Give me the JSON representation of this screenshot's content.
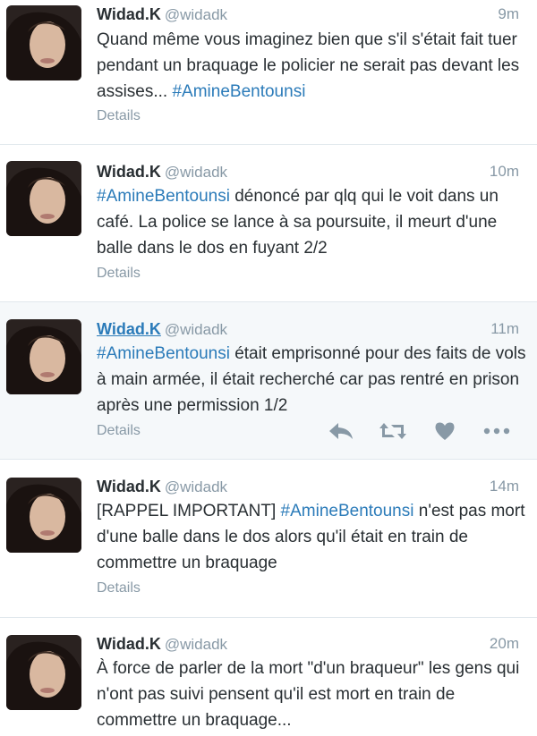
{
  "colors": {
    "name": "#292f33",
    "muted": "#8899a6",
    "hashtag": "#2b7bb9",
    "divider": "#e1e8ed",
    "hover_bg": "#f5f8fa"
  },
  "tweets": [
    {
      "name": "Widad.K",
      "handle": "@widadk",
      "time": "9m",
      "text_pre": "Quand même vous imaginez bien que s'il s'était fait tuer pendant un braquage le policier ne serait pas devant les assises... ",
      "hashtag": "#AmineBentounsi",
      "text_post": "",
      "details": "Details"
    },
    {
      "name": "Widad.K",
      "handle": "@widadk",
      "time": "10m",
      "text_pre": "",
      "hashtag": "#AmineBentounsi",
      "text_post": " dénoncé par qlq qui le voit dans un café. La police se lance à sa poursuite, il meurt d'une balle dans le dos en fuyant 2/2",
      "details": "Details"
    },
    {
      "name": "Widad.K",
      "handle": "@widadk",
      "time": "11m",
      "text_pre": "",
      "hashtag": "#AmineBentounsi",
      "text_post": " était emprisonné pour des faits de vols à main armée, il était recherché car pas rentré en prison après une permission 1/2",
      "details": "Details",
      "actions": [
        "reply-icon",
        "retweet-icon",
        "heart-icon",
        "more-icon"
      ]
    },
    {
      "name": "Widad.K",
      "handle": "@widadk",
      "time": "14m",
      "text_pre": "[RAPPEL IMPORTANT] ",
      "hashtag": "#AmineBentounsi",
      "text_post": " n'est pas mort d'une balle dans le dos alors qu'il était en train de commettre un braquage",
      "details": "Details"
    },
    {
      "name": "Widad.K",
      "handle": "@widadk",
      "time": "20m",
      "text_pre": "À force de parler de la mort \"d'un braqueur\" les gens qui n'ont pas suivi pensent qu'il est mort en train de commettre un braquage...",
      "hashtag": "",
      "text_post": "",
      "details": ""
    }
  ]
}
